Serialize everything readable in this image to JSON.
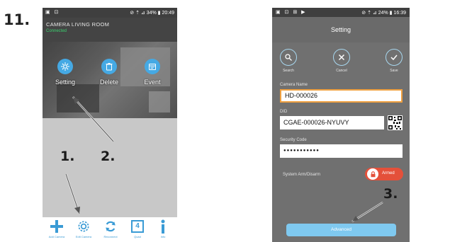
{
  "step": {
    "number": "11."
  },
  "phone1": {
    "status_left": "▣ ⊡",
    "status_right": "⊘ ⇡ ⊿ 34% ▮ 20:49",
    "camera_name": "CAMERA LIVING ROOM",
    "camera_status": "Connected",
    "actions": [
      {
        "label": "Setting",
        "icon": "gear-icon"
      },
      {
        "label": "Delete",
        "icon": "trash-icon"
      },
      {
        "label": "Event",
        "icon": "calendar-icon"
      }
    ],
    "footer_nav": [
      {
        "label": "Add Camera",
        "icon": "plus-icon"
      },
      {
        "label": "Edit Camera",
        "icon": "gear-icon"
      },
      {
        "label": "Reconnect",
        "icon": "refresh-icon"
      },
      {
        "label": "Quad",
        "icon": "quad-view-icon",
        "glyph": "4"
      },
      {
        "label": "Info",
        "icon": "info-icon"
      }
    ]
  },
  "phone2": {
    "status_left": "▣ ⊡ ⊞ ▶",
    "status_right": "⊘ ⇡ ⊿ 24% ▮ 16:39",
    "title": "Setting",
    "toolbar": [
      {
        "label": "Search",
        "icon": "search-icon"
      },
      {
        "label": "Cancel",
        "icon": "close-icon"
      },
      {
        "label": "Save",
        "icon": "check-icon"
      }
    ],
    "camera_name_label": "Camera Name",
    "camera_name_value": "HD-000026",
    "did_label": "DID",
    "did_value": "CGAE-000026-NYUVY",
    "security_code_label": "Security Code",
    "security_code_value": "●●●●●●●●●●●",
    "alarm_label": "System Arm/Disarm",
    "alarm_state": "Armed",
    "advanced_button": "Advanced"
  },
  "annotations": {
    "label1": "1.",
    "label2": "2.",
    "label3": "3."
  },
  "colors": {
    "accent_blue": "#45a9e4",
    "alarm_red": "#e4503a",
    "focus_orange": "#f0a040"
  }
}
